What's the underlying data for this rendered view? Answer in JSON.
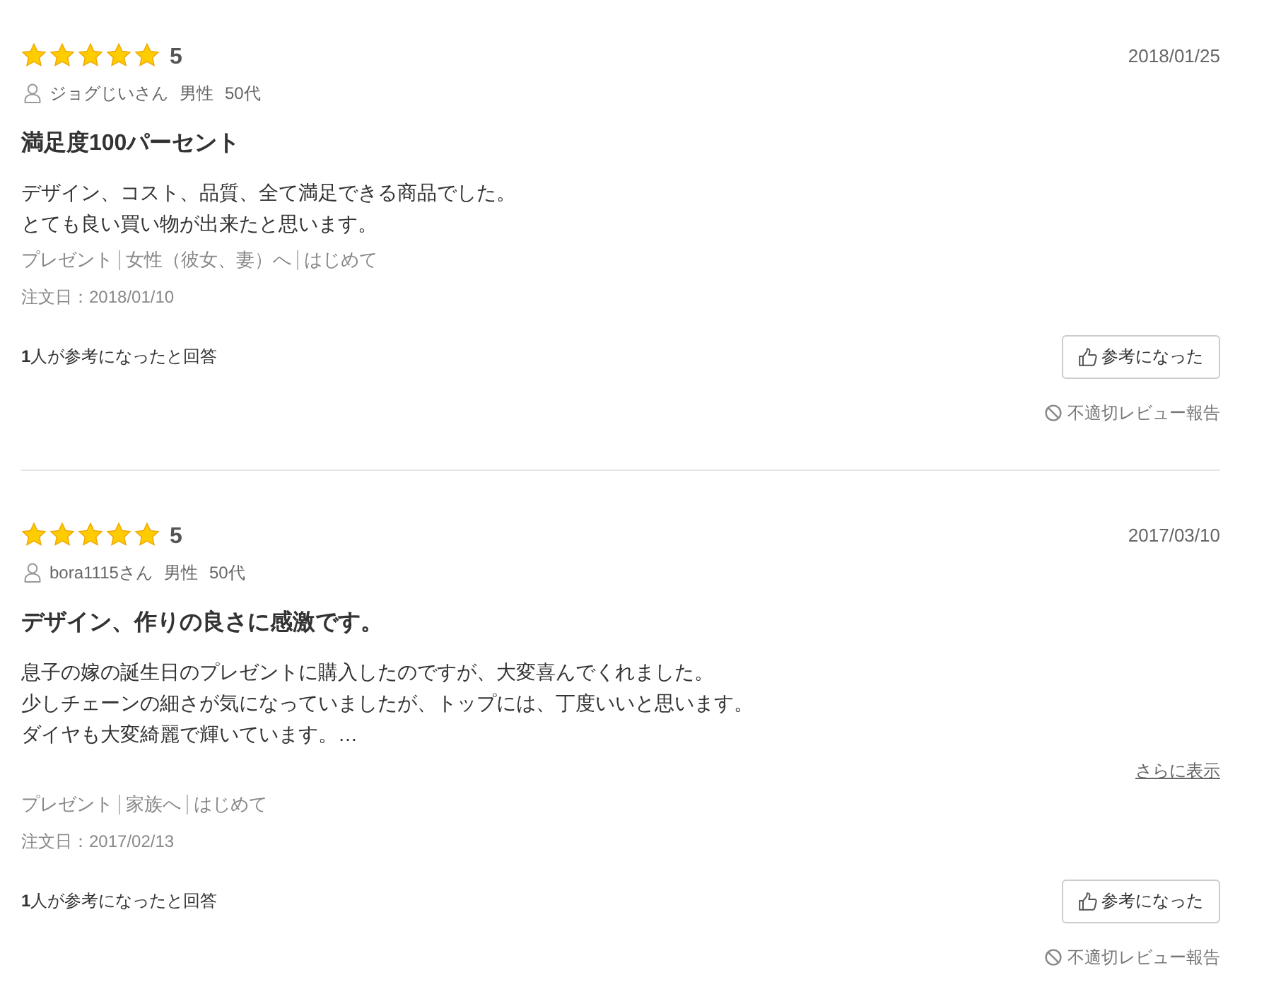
{
  "reviews": [
    {
      "stars": 5,
      "score": "5",
      "date": "2018/01/25",
      "user": {
        "name": "ジョグじいさん",
        "gender": "男性",
        "age": "50代"
      },
      "title": "満足度100パーセント",
      "body_lines": [
        "デザイン、コスト、品質、全て満足できる商品でした。",
        "とても良い買い物が出来たと思います。"
      ],
      "tags": [
        "プレゼント",
        "女性（彼女、妻）へ",
        "はじめて"
      ],
      "order_date": "注文日：2018/01/10",
      "helpful_count": "**1**人が参考になったと回答",
      "helpful_button": "参考になった",
      "report_link": "不適切レビュー報告"
    },
    {
      "stars": 5,
      "score": "5",
      "date": "2017/03/10",
      "user": {
        "name": "bora1115さん",
        "gender": "男性",
        "age": "50代"
      },
      "title": "デザイン、作りの良さに感激です。",
      "body_lines": [
        "息子の嫁の誕生日のプレゼントに購入したのですが、大変喜んでくれました。",
        "少しチェーンの細さが気になっていましたが、トップには、丁度いいと思います。",
        "ダイヤも大変綺麗で輝いています。…"
      ],
      "more_link": "さらに表示",
      "tags": [
        "プレゼント",
        "家族へ",
        "はじめて"
      ],
      "order_date": "注文日：2017/02/13",
      "helpful_count": "**1**人が参考になったと回答",
      "helpful_button": "参考になった",
      "report_link": "不適切レビュー報告"
    }
  ]
}
